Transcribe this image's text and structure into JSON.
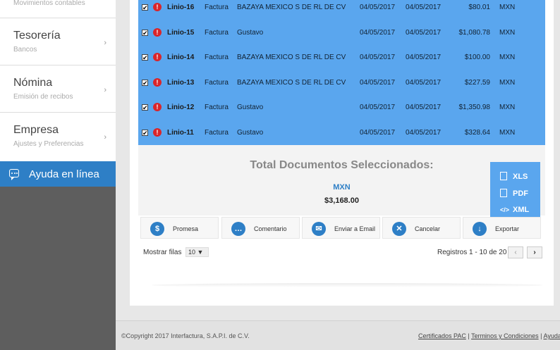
{
  "sidebar": {
    "top_subtitle": "Movimientos contables",
    "items": [
      {
        "title": "Tesorería",
        "subtitle": "Bancos"
      },
      {
        "title": "Nómina",
        "subtitle": "Emisión de recibos"
      },
      {
        "title": "Empresa",
        "subtitle": "Ajustes y Preferencias"
      }
    ],
    "help_label": "Ayuda en línea"
  },
  "rows": [
    {
      "id": "Linio-16",
      "type": "Factura",
      "name": "BAZAYA MEXICO S DE RL DE CV",
      "date1": "04/05/2017",
      "date2": "04/05/2017",
      "amount": "$80.01",
      "currency": "MXN"
    },
    {
      "id": "Linio-15",
      "type": "Factura",
      "name": "Gustavo",
      "date1": "04/05/2017",
      "date2": "04/05/2017",
      "amount": "$1,080.78",
      "currency": "MXN"
    },
    {
      "id": "Linio-14",
      "type": "Factura",
      "name": "BAZAYA MEXICO S DE RL DE CV",
      "date1": "04/05/2017",
      "date2": "04/05/2017",
      "amount": "$100.00",
      "currency": "MXN"
    },
    {
      "id": "Linio-13",
      "type": "Factura",
      "name": "BAZAYA MEXICO S DE RL DE CV",
      "date1": "04/05/2017",
      "date2": "04/05/2017",
      "amount": "$227.59",
      "currency": "MXN"
    },
    {
      "id": "Linio-12",
      "type": "Factura",
      "name": "Gustavo",
      "date1": "04/05/2017",
      "date2": "04/05/2017",
      "amount": "$1,350.98",
      "currency": "MXN"
    },
    {
      "id": "Linio-11",
      "type": "Factura",
      "name": "Gustavo",
      "date1": "04/05/2017",
      "date2": "04/05/2017",
      "amount": "$328.64",
      "currency": "MXN"
    }
  ],
  "row_icons": {
    "checkbox": "✔",
    "warning": "!"
  },
  "total": {
    "title": "Total Documentos Seleccionados:",
    "currency": "MXN",
    "amount": "$3,168.00"
  },
  "export_menu": [
    "XLS",
    "PDF",
    "XML"
  ],
  "actions": [
    "Promesa",
    "Comentario",
    "Enviar a Email",
    "Cancelar",
    "Exportar"
  ],
  "pager": {
    "show_label": "Mostrar filas",
    "rows_per_page": "10",
    "records": "Registros 1 - 10 de 20",
    "prev": "‹",
    "next": "›"
  },
  "footer": {
    "copyright": "©Copyright 2017 Interfactura, S.A.P.I. de C.V.",
    "links": [
      "Certificados PAC",
      "Terminos y Condiciones",
      "Ayuda"
    ],
    "separator": "|"
  },
  "colors": {
    "accent": "#2e7fc6",
    "row_bg": "#5aa6ee",
    "warning": "#d9252a"
  }
}
